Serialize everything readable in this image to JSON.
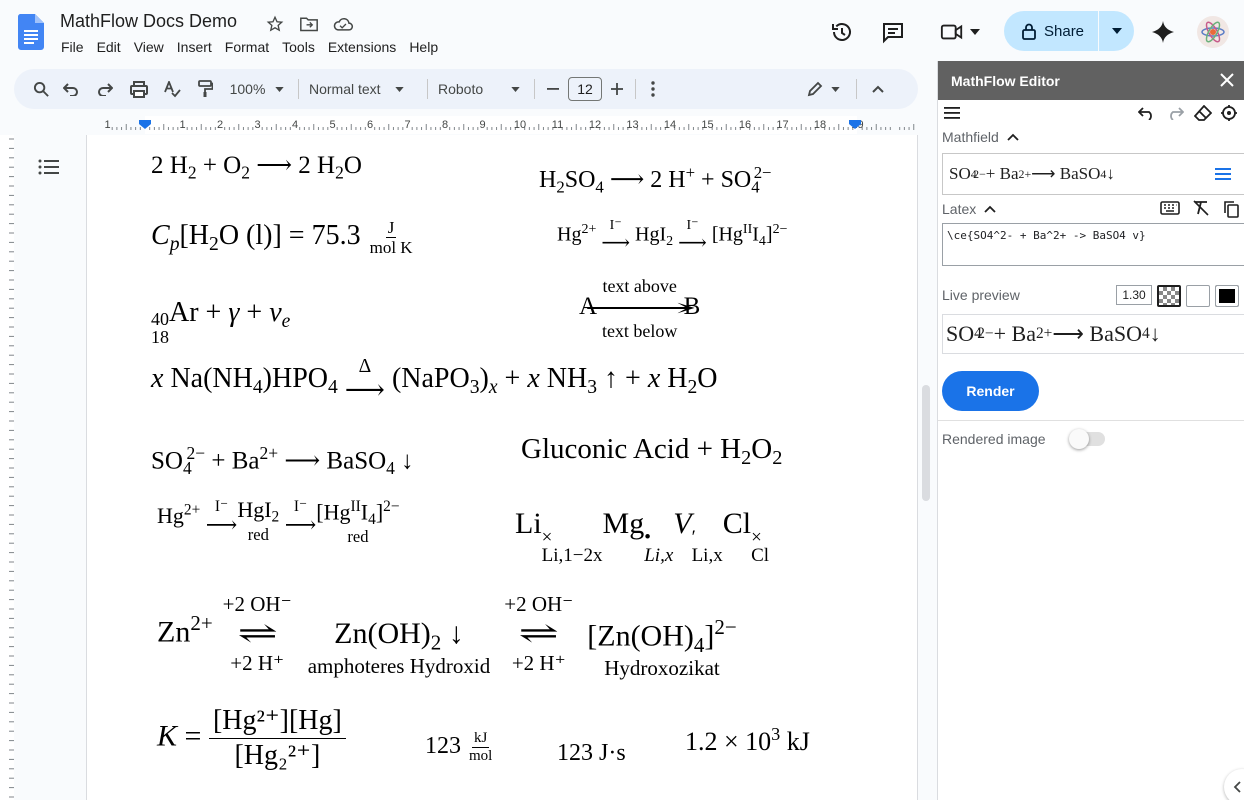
{
  "doc": {
    "title": "MathFlow Docs Demo",
    "menu": [
      "File",
      "Edit",
      "View",
      "Insert",
      "Format",
      "Tools",
      "Extensions",
      "Help"
    ]
  },
  "header": {
    "share_label": "Share"
  },
  "toolbar": {
    "zoom": "100%",
    "style": "Normal text",
    "font": "Roboto",
    "font_size": "12"
  },
  "ruler": {
    "numbers": [
      "1",
      "1",
      "2",
      "3",
      "4",
      "5",
      "6",
      "7",
      "8",
      "9",
      "10",
      "11",
      "12",
      "13",
      "14",
      "15",
      "16",
      "17",
      "18",
      "19"
    ]
  },
  "equations": {
    "e1": {
      "a": "2 H",
      "b": "2",
      "c": " + O",
      "d": "2",
      "e": " ⟶ 2 H",
      "f": "2",
      "g": "O"
    },
    "e2": {
      "a": "H",
      "b": "2",
      "c": "SO",
      "d": "4",
      "e": " ⟶ 2 H",
      "f": "+",
      "g": " + SO",
      "h": "4",
      "i": "2−"
    },
    "e3": {
      "a": "C",
      "b": "p",
      "c": "[H",
      "d": "2",
      "e": "O (l)] = 75.3 ",
      "num": "J",
      "den": "mol K"
    },
    "e4": {
      "a": "Hg",
      "b": "2+",
      "lbl1": "I⁻",
      "arr": "⟶",
      "c": " HgI",
      "d": "2",
      "lbl2": "I⁻",
      "e": " [Hg",
      "f": "II",
      "g": "I",
      "h": "4",
      "i": "]",
      "j": "2−"
    },
    "e5": {
      "a": "40",
      "b": "18",
      "c": "Ar + ",
      "d": "γ",
      "e": " + ",
      "f": "ν",
      "g": "e"
    },
    "e6": {
      "a": "A ",
      "above": "text above",
      "arr": "⟶",
      "below": "text below",
      "b": " B"
    },
    "e7": {
      "a": "x",
      "b": " Na(NH",
      "c": "4",
      "d": ")HPO",
      "e": "4",
      "lbl": "Δ",
      "arr": "⟶",
      "f": " (NaPO",
      "g": "3",
      "h": ")",
      "i": "x",
      "j": " + ",
      "k": "x",
      "l": " NH",
      "m": "3",
      "n": " ↑ + ",
      "o": "x",
      "p": " H",
      "q": "2",
      "r": "O"
    },
    "e8": {
      "a": "SO",
      "b": "4",
      "c": "2−",
      "d": " + Ba",
      "e": "2+",
      "f": " ⟶ BaSO",
      "g": "4",
      "h": " ↓"
    },
    "e9": {
      "a": "Gluconic Acid + H",
      "b": "2",
      "c": "O",
      "d": "2"
    },
    "e10": {
      "a": "Hg",
      "b": "2+",
      "lbl1": "I⁻",
      "arr": "⟶",
      "c": " HgI",
      "d": "2",
      "u1": "red",
      "lbl2": "I⁻",
      "e": " [Hg",
      "f": "II",
      "g": "I",
      "h": "4",
      "i": "]",
      "j": "2−",
      "u2": "red"
    },
    "e11": {
      "a": "Li",
      "b": "×",
      "c": "Li,1−2x",
      "d": "Mg",
      "e": "•",
      "f": "Li,x",
      "g": "V",
      "h": "′",
      "i": "Li,x",
      "j": "Cl",
      "k": "×",
      "l": "Cl"
    },
    "e12": {
      "a": "Zn",
      "b": "2+",
      "top1": "+2 OH⁻",
      "arr": "⇌",
      "bot1": "+2 H⁺",
      "c": "Zn(OH)",
      "d": "2",
      "e": " ↓",
      "u1": "amphoteres Hydroxid",
      "top2": "+2 OH⁻",
      "bot2": "+2 H⁺",
      "f": "[Zn(OH)",
      "g": "4",
      "h": "]",
      "i": "2−",
      "u2": "Hydroxozikat"
    },
    "e13": {
      "a": "K",
      "b": " = ",
      "num": "[Hg²⁺][Hg]",
      "den": "[Hg₂²⁺]"
    },
    "e14": {
      "a": "123 ",
      "num": "kJ",
      "den": "mol"
    },
    "e15": {
      "a": "123 J·s"
    },
    "e16": {
      "a": "1.2 × 10",
      "b": "3",
      "c": " kJ"
    }
  },
  "panel": {
    "title": "MathFlow Editor",
    "mathfield_label": "Mathfield",
    "mathfield": {
      "a": "SO",
      "b": "4",
      "c": "2−",
      "d": " + Ba",
      "e": "2+",
      "f": " ⟶ BaSO",
      "g": "4",
      "h": " ↓"
    },
    "latex_label": "Latex",
    "latex_value": "\\ce{SO4^2- + Ba^2+ -> BaSO4 v}",
    "preview_label": "Live preview",
    "scale": "1.30",
    "preview": {
      "a": "SO",
      "b": "4",
      "c": "2−",
      "d": " + Ba",
      "e": "2+",
      "f": " ⟶ BaSO",
      "g": "4",
      "h": " ↓"
    },
    "render_label": "Render",
    "rendered_image_label": "Rendered image"
  }
}
